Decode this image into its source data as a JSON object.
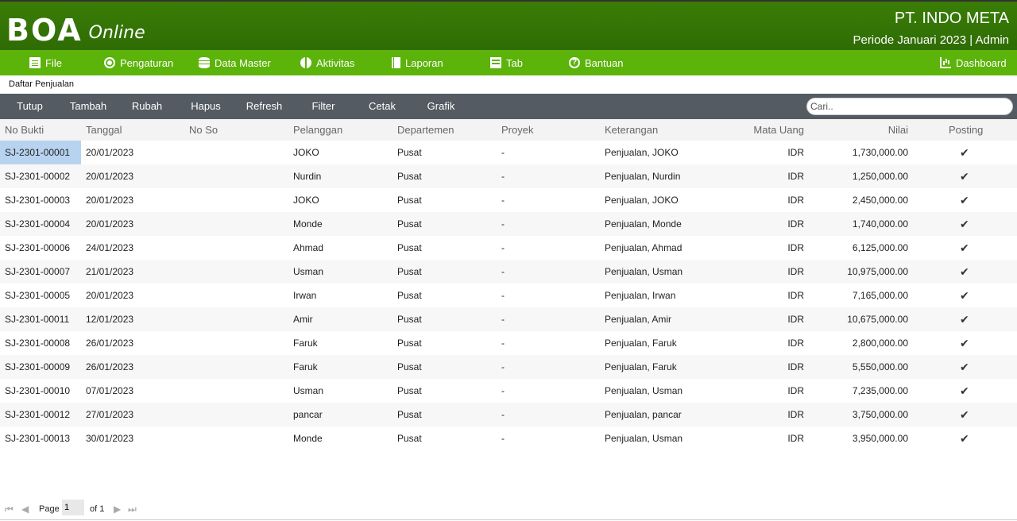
{
  "header": {
    "logo_text": "BOA",
    "logo_sub": "Online",
    "company": "PT. INDO META",
    "period": "Periode Januari 2023 | Admin"
  },
  "menu": [
    {
      "label": "File",
      "icon": "file-icon"
    },
    {
      "label": "Pengaturan",
      "icon": "gear-icon"
    },
    {
      "label": "Data Master",
      "icon": "database-icon"
    },
    {
      "label": "Aktivitas",
      "icon": "globe-icon"
    },
    {
      "label": "Laporan",
      "icon": "book-icon"
    },
    {
      "label": "Tab",
      "icon": "table-icon"
    },
    {
      "label": "Bantuan",
      "icon": "help-icon"
    },
    {
      "label": "Dashboard",
      "icon": "chart-icon"
    }
  ],
  "breadcrumb": "Daftar Penjualan",
  "toolbar": {
    "buttons": [
      "Tutup",
      "Tambah",
      "Rubah",
      "Hapus",
      "Refresh",
      "Filter",
      "Cetak",
      "Grafik"
    ],
    "search_placeholder": "Cari.."
  },
  "columns": [
    "No Bukti",
    "Tanggal",
    "No So",
    "Pelanggan",
    "Departemen",
    "Proyek",
    "Keterangan",
    "Mata Uang",
    "Nilai",
    "Posting"
  ],
  "rows": [
    [
      "SJ-2301-00001",
      "20/01/2023",
      "",
      "JOKO",
      "Pusat",
      "-",
      "Penjualan, JOKO",
      "IDR",
      "1,730,000.00",
      "✔"
    ],
    [
      "SJ-2301-00002",
      "20/01/2023",
      "",
      "Nurdin",
      "Pusat",
      "-",
      "Penjualan, Nurdin",
      "IDR",
      "1,250,000.00",
      "✔"
    ],
    [
      "SJ-2301-00003",
      "20/01/2023",
      "",
      "JOKO",
      "Pusat",
      "-",
      "Penjualan, JOKO",
      "IDR",
      "2,450,000.00",
      "✔"
    ],
    [
      "SJ-2301-00004",
      "20/01/2023",
      "",
      "Monde",
      "Pusat",
      "-",
      "Penjualan, Monde",
      "IDR",
      "1,740,000.00",
      "✔"
    ],
    [
      "SJ-2301-00006",
      "24/01/2023",
      "",
      "Ahmad",
      "Pusat",
      "-",
      "Penjualan, Ahmad",
      "IDR",
      "6,125,000.00",
      "✔"
    ],
    [
      "SJ-2301-00007",
      "21/01/2023",
      "",
      "Usman",
      "Pusat",
      "-",
      "Penjualan, Usman",
      "IDR",
      "10,975,000.00",
      "✔"
    ],
    [
      "SJ-2301-00005",
      "20/01/2023",
      "",
      "Irwan",
      "Pusat",
      "-",
      "Penjualan, Irwan",
      "IDR",
      "7,165,000.00",
      "✔"
    ],
    [
      "SJ-2301-00011",
      "12/01/2023",
      "",
      "Amir",
      "Pusat",
      "-",
      "Penjualan, Amir",
      "IDR",
      "10,675,000.00",
      "✔"
    ],
    [
      "SJ-2301-00008",
      "26/01/2023",
      "",
      "Faruk",
      "Pusat",
      "-",
      "Penjualan, Faruk",
      "IDR",
      "2,800,000.00",
      "✔"
    ],
    [
      "SJ-2301-00009",
      "26/01/2023",
      "",
      "Faruk",
      "Pusat",
      "-",
      "Penjualan, Faruk",
      "IDR",
      "5,550,000.00",
      "✔"
    ],
    [
      "SJ-2301-00010",
      "07/01/2023",
      "",
      "Usman",
      "Pusat",
      "-",
      "Penjualan, Usman",
      "IDR",
      "7,235,000.00",
      "✔"
    ],
    [
      "SJ-2301-00012",
      "27/01/2023",
      "",
      "pancar",
      "Pusat",
      "-",
      "Penjualan, pancar",
      "IDR",
      "3,750,000.00",
      "✔"
    ],
    [
      "SJ-2301-00013",
      "30/01/2023",
      "",
      "Monde",
      "Pusat",
      "-",
      "Penjualan, Usman",
      "IDR",
      "3,950,000.00",
      "✔"
    ]
  ],
  "pager": {
    "page_label": "Page",
    "page_value": "1",
    "of_label": "of 1"
  }
}
